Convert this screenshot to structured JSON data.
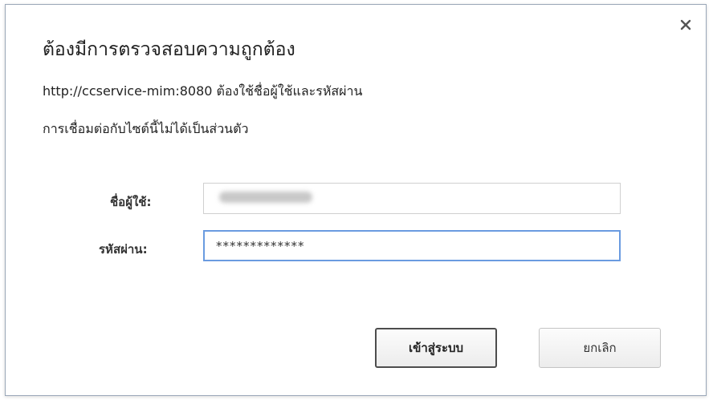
{
  "dialog": {
    "title": "ต้องมีการตรวจสอบความถูกต้อง",
    "message_line1": "http://ccservice-mim:8080 ต้องใช้ชื่อผู้ใช้และรหัสผ่าน",
    "message_line2": "การเชื่อมต่อกับไซต์นี้ไม่ได้เป็นส่วนตัว",
    "close_icon": "close-icon"
  },
  "form": {
    "username_label": "ชื่อผู้ใช้:",
    "username_value": "",
    "password_label": "รหัสผ่าน:",
    "password_value": "*************"
  },
  "buttons": {
    "login_label": "เข้าสู่ระบบ",
    "cancel_label": "ยกเลิก"
  },
  "colors": {
    "focus_border": "#6a9be0",
    "dialog_border": "#9aa7b8"
  }
}
